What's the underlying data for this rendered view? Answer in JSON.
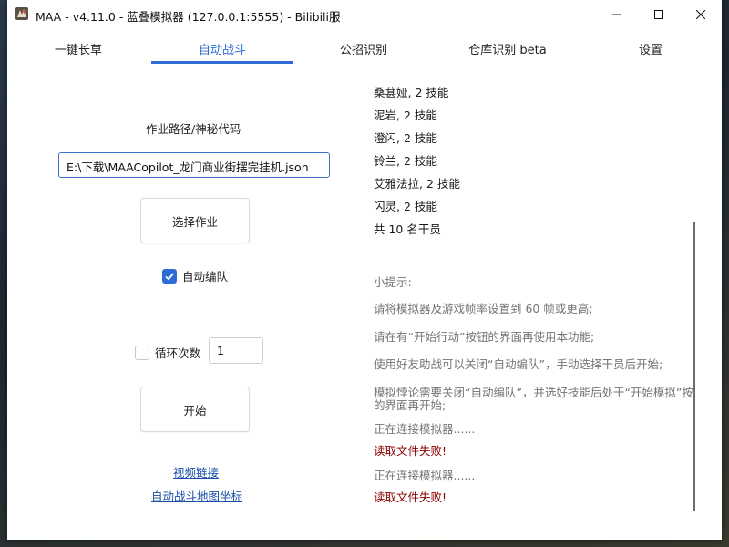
{
  "window": {
    "title": "MAA - v4.11.0 - 蓝叠模拟器 (127.0.0.1:5555) - Bilibili服"
  },
  "tabs": [
    {
      "label": "一键长草",
      "active": false
    },
    {
      "label": "自动战斗",
      "active": true
    },
    {
      "label": "公招识别",
      "active": false
    },
    {
      "label": "仓库识别 beta",
      "active": false
    },
    {
      "label": "设置",
      "active": false
    }
  ],
  "left": {
    "path_label": "作业路径/神秘代码",
    "path_value": "E:\\下载\\MAACopilot_龙门商业街摆完挂机.json",
    "select_button": "选择作业",
    "auto_formation": {
      "label": "自动编队",
      "checked": true
    },
    "loop": {
      "label": "循环次数",
      "checked": false,
      "value": "1"
    },
    "start_button": "开始",
    "link_video": "视频链接",
    "link_map": "自动战斗地图坐标"
  },
  "log": {
    "lines": [
      {
        "text": "桑葚娅, 2 技能",
        "tone": "dark"
      },
      {
        "text": "泥岩, 2 技能",
        "tone": "dark"
      },
      {
        "text": "澄闪, 2 技能",
        "tone": "dark"
      },
      {
        "text": "铃兰, 2 技能",
        "tone": "dark"
      },
      {
        "text": "艾雅法拉, 2 技能",
        "tone": "dark"
      },
      {
        "text": "闪灵, 2 技能",
        "tone": "dark"
      },
      {
        "text": "共 10 名干员",
        "tone": "dark"
      },
      {
        "text": "小提示:",
        "tone": "gray"
      },
      {
        "text": "请将模拟器及游戏帧率设置到 60 帧或更高;",
        "tone": "gray"
      },
      {
        "text": "请在有“开始行动”按钮的界面再使用本功能;",
        "tone": "gray"
      },
      {
        "text": "使用好友助战可以关闭“自动编队”，手动选择干员后开始;",
        "tone": "gray"
      },
      {
        "text": "模拟悖论需要关闭“自动编队”，并选好技能后处于“开始模拟”按钮",
        "tone": "gray"
      },
      {
        "text": "的界面再开始;",
        "tone": "gray"
      },
      {
        "text": "正在连接模拟器......",
        "tone": "gray"
      },
      {
        "text": "读取文件失败!",
        "tone": "red"
      },
      {
        "text": "正在连接模拟器......",
        "tone": "gray"
      },
      {
        "text": "读取文件失败!",
        "tone": "red"
      }
    ]
  },
  "colors": {
    "accent": "#2e6bd6",
    "error": "#8b0000",
    "hint": "#757575"
  }
}
